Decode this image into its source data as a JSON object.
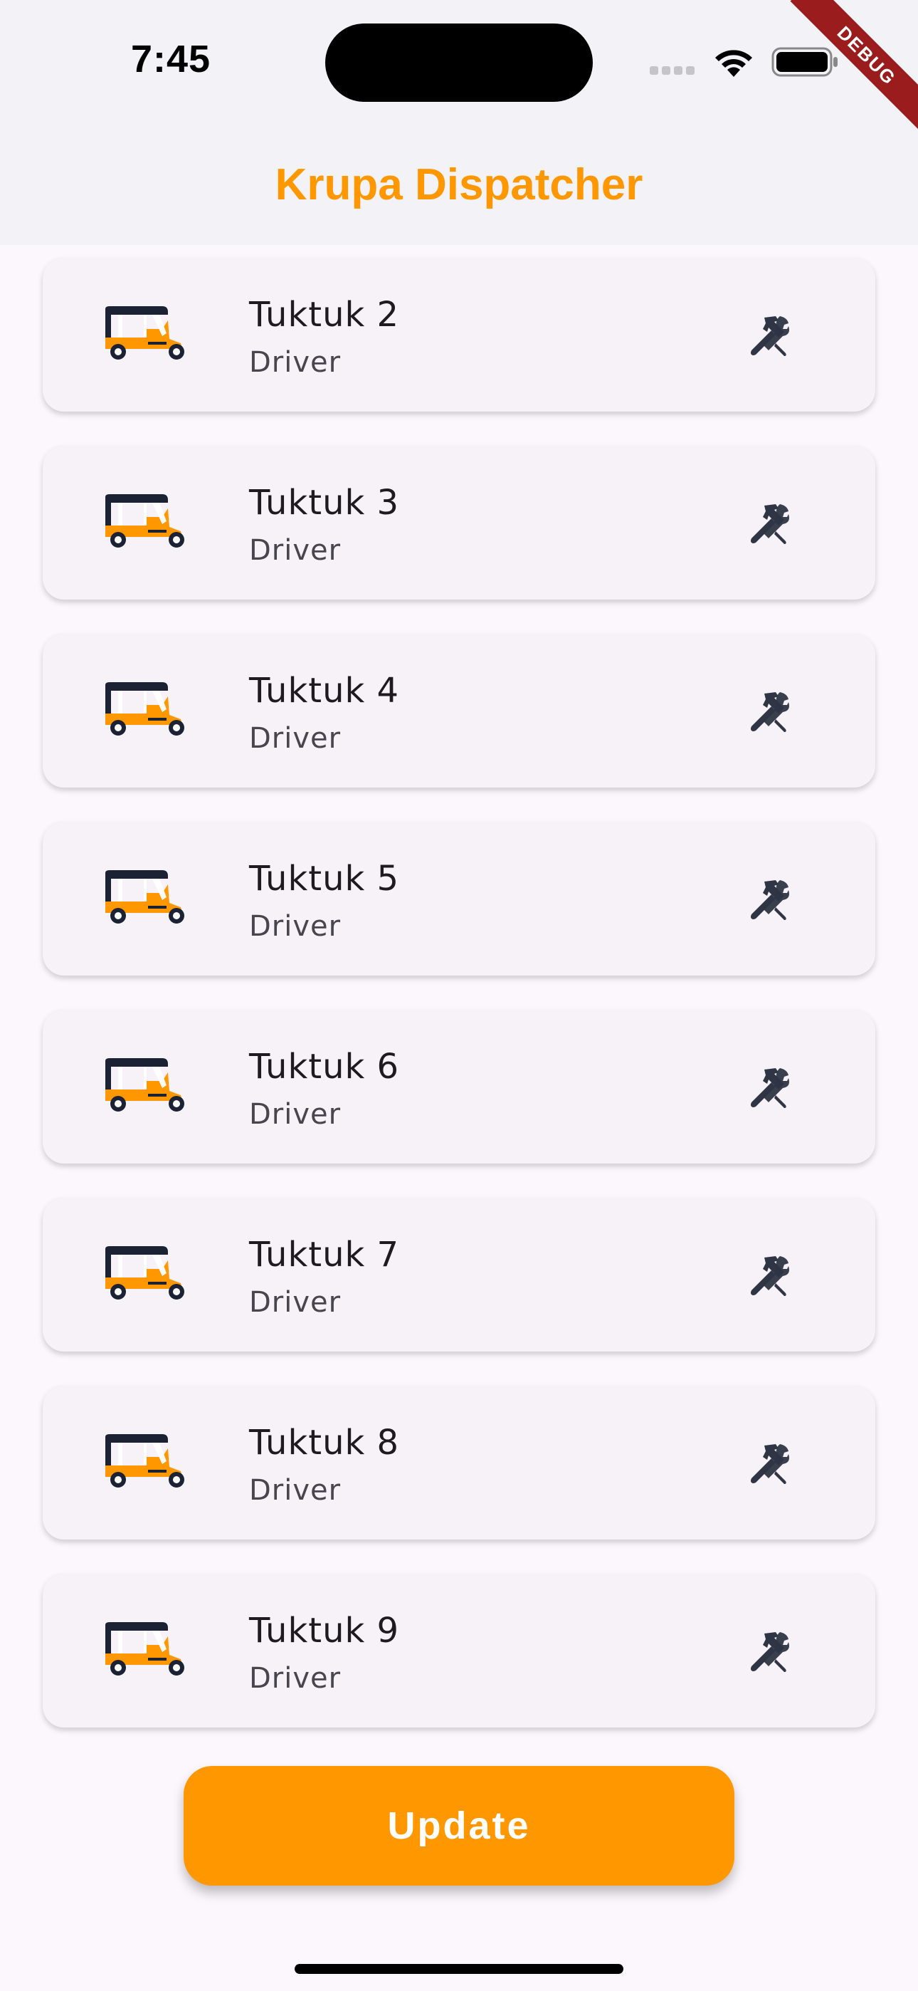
{
  "status_bar": {
    "time": "7:45"
  },
  "debug_banner": "DEBUG",
  "app_bar": {
    "title": "Krupa Dispatcher"
  },
  "vehicles": [
    {
      "name": "Tuktuk 2",
      "role": "Driver"
    },
    {
      "name": "Tuktuk 3",
      "role": "Driver"
    },
    {
      "name": "Tuktuk 4",
      "role": "Driver"
    },
    {
      "name": "Tuktuk 5",
      "role": "Driver"
    },
    {
      "name": "Tuktuk 6",
      "role": "Driver"
    },
    {
      "name": "Tuktuk 7",
      "role": "Driver"
    },
    {
      "name": "Tuktuk 8",
      "role": "Driver"
    },
    {
      "name": "Tuktuk 9",
      "role": "Driver"
    }
  ],
  "icons": {
    "vehicle": "tuktuk-icon",
    "action": "tools-icon"
  },
  "update_button": {
    "label": "Update"
  },
  "colors": {
    "accent": "#ff9800",
    "header_bg": "#f2f2f7",
    "card_bg": "#f7f2f8",
    "icon": "#2f3545"
  }
}
